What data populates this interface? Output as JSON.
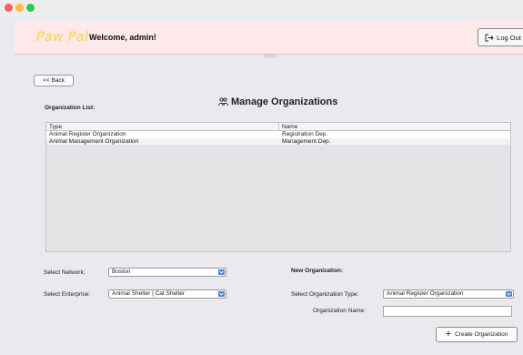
{
  "header": {
    "brand": "Paw Pal",
    "welcome": "Welcome, admin!",
    "logout_label": "Log Out",
    "logout_icon": "logout-arrow-icon"
  },
  "back_label": "<< Back",
  "page_title": "Manage Organizations",
  "page_title_icon": "organization-people-icon",
  "org_list": {
    "label": "Organization List:",
    "columns": [
      "Type",
      "Name"
    ],
    "rows": [
      [
        "Animal Register Organization",
        "Registration Dep."
      ],
      [
        "Animal Management Organization",
        "Management Dep."
      ]
    ]
  },
  "network": {
    "label": "Select Network:",
    "value": "Boston"
  },
  "enterprise": {
    "label": "Select Enterprise:",
    "value": "Animal Shelter | Cat Shelter"
  },
  "new_org": {
    "heading": "New Organization:",
    "type_label": "Select Organization Type:",
    "type_value": "Animal Register Organization",
    "name_label": "Organization Name:",
    "name_value": ""
  },
  "create_label": "Create Organization",
  "colors": {
    "header_bg": "#fde8ea",
    "brand": "#f3d24a",
    "dropdown_arrow": "#4a7fd8"
  }
}
